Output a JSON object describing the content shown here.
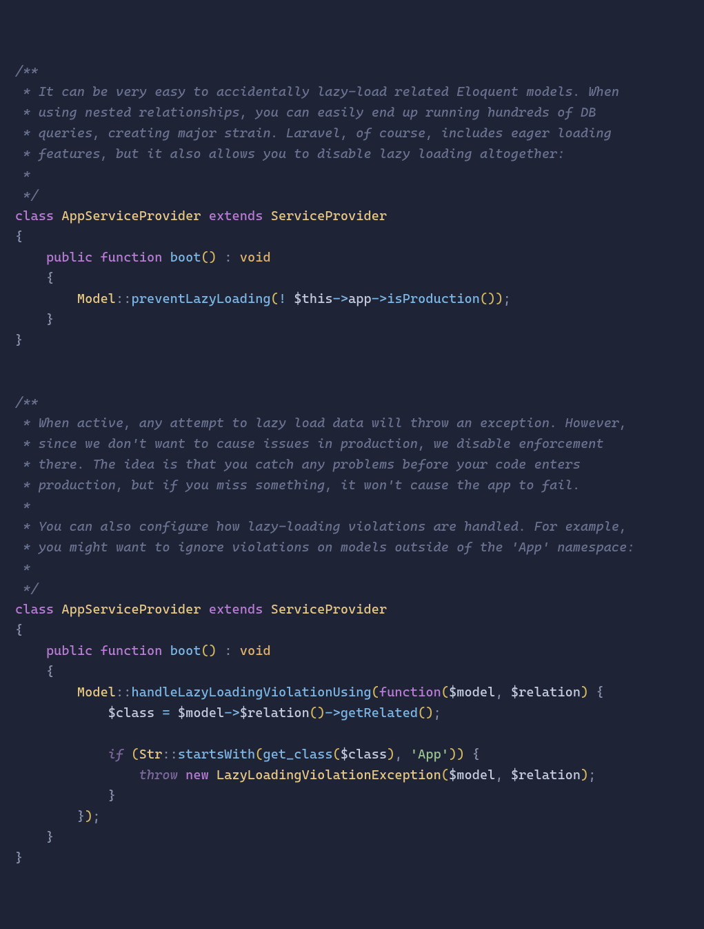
{
  "code": {
    "block1": {
      "comment_start": "/**",
      "comment_l1": " * It can be very easy to accidentally lazy-load related Eloquent models. When",
      "comment_l2": " * using nested relationships, you can easily end up running hundreds of DB",
      "comment_l3": " * queries, creating major strain. Laravel, of course, includes eager loading",
      "comment_l4": " * features, but it also allows you to disable lazy loading altogether:",
      "comment_l5": " *",
      "comment_end": " */",
      "kw_class": "class",
      "cls_name": "AppServiceProvider",
      "kw_extends": "extends",
      "parent": "ServiceProvider",
      "brace_open": "{",
      "kw_public": "public",
      "kw_function": "function",
      "fn_boot": "boot",
      "paren_l": "(",
      "paren_r": ")",
      "colon": ":",
      "ret_type": "void",
      "body_brace_open": "{",
      "model": "Model",
      "dcolon": "::",
      "prevent": "preventLazyLoading",
      "call_l": "(",
      "bang": "! ",
      "this": "$this",
      "arrow": "->",
      "app": "app",
      "isProd": "isProduction",
      "call_r": ")",
      "call_rr": ")",
      "semi": ";",
      "body_brace_close": "}",
      "brace_close": "}"
    },
    "block2": {
      "comment_start": "/**",
      "comment_l1": " * When active, any attempt to lazy load data will throw an exception. However,",
      "comment_l2": " * since we don't want to cause issues in production, we disable enforcement",
      "comment_l3": " * there. The idea is that you catch any problems before your code enters",
      "comment_l4": " * production, but if you miss something, it won't cause the app to fail.",
      "comment_l5": " *",
      "comment_l6": " * You can also configure how lazy-loading violations are handled. For example,",
      "comment_l7": " * you might want to ignore violations on models outside of the 'App' namespace:",
      "comment_l8": " *",
      "comment_end": " */",
      "kw_class": "class",
      "cls_name": "AppServiceProvider",
      "kw_extends": "extends",
      "parent": "ServiceProvider",
      "brace_open": "{",
      "kw_public": "public",
      "kw_function": "function",
      "fn_boot": "boot",
      "paren_l": "(",
      "paren_r": ")",
      "colon": ":",
      "ret_type": "void",
      "body_brace_open": "{",
      "model": "Model",
      "dcolon": "::",
      "handle": "handleLazyLoadingViolationUsing",
      "call_l": "(",
      "kw_function_cb": "function",
      "cb_l": "(",
      "p_model": "$model",
      "comma": ", ",
      "p_relation": "$relation",
      "cb_r": ")",
      "cb_brace_open": "{",
      "v_class": "$class",
      "eq": " = ",
      "v_model": "$model",
      "arrow": "->",
      "v_relation_call": "$relation",
      "paren_lr": "()",
      "getRelated": "getRelated",
      "semi": ";",
      "kw_if": "if",
      "if_l": "(",
      "str_cls": "Str",
      "startsWith": "startsWith",
      "sw_l": "(",
      "get_class": "get_class",
      "gc_l": "(",
      "v_class2": "$class",
      "gc_r": ")",
      "comma2": ", ",
      "str_app": "'App'",
      "sw_r": ")",
      "if_r": ")",
      "if_brace_open": "{",
      "kw_throw": "throw",
      "kw_new": "new",
      "exc": "LazyLoadingViolationException",
      "exc_l": "(",
      "exc_model": "$model",
      "exc_comma": ", ",
      "exc_relation": "$relation",
      "exc_r": ")",
      "exc_semi": ";",
      "if_brace_close": "}",
      "cb_brace_close": "}",
      "outer_r": ")",
      "outer_semi": ";",
      "body_brace_close": "}",
      "brace_close": "}"
    }
  }
}
